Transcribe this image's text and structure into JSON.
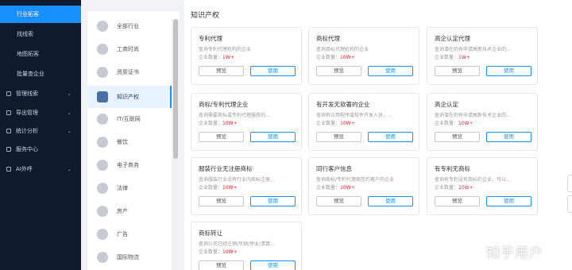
{
  "sidebar": {
    "sub_items": [
      {
        "label": "行业拓客",
        "active": true
      },
      {
        "label": "找线索",
        "active": false
      },
      {
        "label": "地图拓客",
        "active": false
      },
      {
        "label": "批量查企业",
        "active": false
      }
    ],
    "top_items": [
      {
        "label": "管理线索",
        "icon": "folder-icon",
        "has_arrow": true
      },
      {
        "label": "导出管理",
        "icon": "export-icon",
        "has_arrow": true
      },
      {
        "label": "统计分析",
        "icon": "chart-icon",
        "has_arrow": true
      },
      {
        "label": "服务中心",
        "icon": "service-icon",
        "has_arrow": false
      },
      {
        "label": "AI外呼",
        "icon": "phone-icon",
        "has_arrow": true
      }
    ],
    "arrow_glyph": "⌄",
    "colors": {
      "background": "#0f1b2d",
      "active": "#1890ff"
    }
  },
  "categories": [
    {
      "label": "全部行业",
      "icon": "grid-icon",
      "active": false
    },
    {
      "label": "工商时尚",
      "icon": "shop-icon",
      "active": false
    },
    {
      "label": "资质证书",
      "icon": "certificate-icon",
      "active": false
    },
    {
      "label": "知识产权",
      "icon": "document-icon",
      "active": true
    },
    {
      "label": "IT/互联网",
      "icon": "internet-icon",
      "active": false
    },
    {
      "label": "餐饮",
      "icon": "dining-icon",
      "active": false
    },
    {
      "label": "电子商务",
      "icon": "cart-icon",
      "active": false
    },
    {
      "label": "法律",
      "icon": "gavel-icon",
      "active": false
    },
    {
      "label": "房产",
      "icon": "house-icon",
      "active": false
    },
    {
      "label": "广告",
      "icon": "megaphone-icon",
      "active": false
    },
    {
      "label": "国际物流",
      "icon": "globe-icon",
      "active": false
    }
  ],
  "main": {
    "title": "知识产权",
    "count_label": "企业数量：",
    "preview_label": "预览",
    "use_label": "使用",
    "cards": [
      {
        "title": "专利代理",
        "desc": "查询专利代理机构的企业",
        "count": "1W+"
      },
      {
        "title": "商标代理",
        "desc": "查询商标代理机构的企业",
        "count": "10W+"
      },
      {
        "title": "高企认定代理",
        "desc": "查询潜在的有申请高新技术企业的...",
        "count": "1W+"
      },
      {
        "title": "商标/专利代理企业",
        "desc": "查询需要商标或专利代理服务的...",
        "count": "10W+"
      },
      {
        "title": "有开发无软著的企业",
        "desc": "查询有应用程序或软件开发人员，...",
        "count": "10W+"
      },
      {
        "title": "高企认定",
        "desc": "查询潜在的有申请高新技术企业的...",
        "count": "10W+"
      },
      {
        "title": "服装行业无注册商标",
        "desc": "查询服装行业没有行业内商标注册...",
        "count": "10W+"
      },
      {
        "title": "同行客户信息",
        "desc": "查询商标/专利代理商签约客户的企业",
        "count": "10W+"
      },
      {
        "title": "有专利无商标",
        "desc": "查询有专利没有商标的企业，可以...",
        "count": "10W+"
      },
      {
        "title": "商标转让",
        "desc": "查询公司已经注销/吊销/停业/清算...",
        "count": "10W+"
      }
    ],
    "colors": {
      "accent": "#1890ff",
      "count": "#f5222d"
    }
  },
  "watermark": "知乎用户"
}
